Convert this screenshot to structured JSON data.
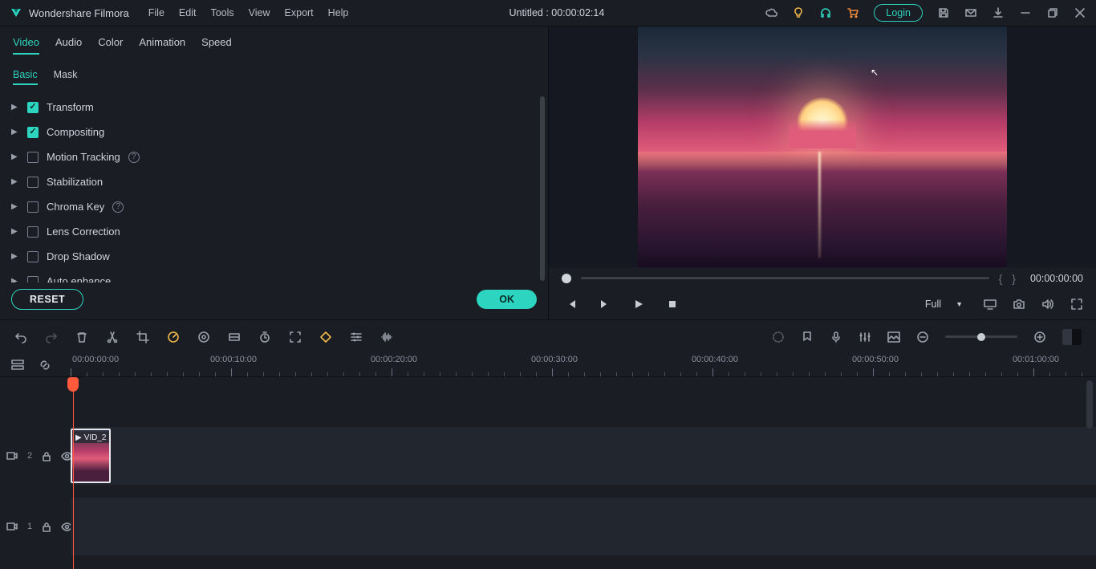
{
  "app": {
    "name": "Wondershare Filmora",
    "title_center": "Untitled : 00:00:02:14",
    "login": "Login"
  },
  "menu": [
    "File",
    "Edit",
    "Tools",
    "View",
    "Export",
    "Help"
  ],
  "category_tabs": [
    "Video",
    "Audio",
    "Color",
    "Animation",
    "Speed"
  ],
  "sub_tabs": [
    "Basic",
    "Mask"
  ],
  "props": [
    {
      "label": "Transform",
      "checked": true,
      "help": false
    },
    {
      "label": "Compositing",
      "checked": true,
      "help": false
    },
    {
      "label": "Motion Tracking",
      "checked": false,
      "help": true
    },
    {
      "label": "Stabilization",
      "checked": false,
      "help": false
    },
    {
      "label": "Chroma Key",
      "checked": false,
      "help": true
    },
    {
      "label": "Lens Correction",
      "checked": false,
      "help": false
    },
    {
      "label": "Drop Shadow",
      "checked": false,
      "help": false
    },
    {
      "label": "Auto enhance",
      "checked": false,
      "help": false
    }
  ],
  "buttons": {
    "reset": "RESET",
    "ok": "OK"
  },
  "preview": {
    "time": "00:00:00:00",
    "quality": "Full"
  },
  "ruler": [
    "00:00:00:00",
    "00:00:10:00",
    "00:00:20:00",
    "00:00:30:00",
    "00:00:40:00",
    "00:00:50:00",
    "00:01:00:00"
  ],
  "tracks": [
    {
      "id": "2",
      "label": "2"
    },
    {
      "id": "1",
      "label": "1"
    }
  ],
  "clip": {
    "name": "VID_2"
  }
}
